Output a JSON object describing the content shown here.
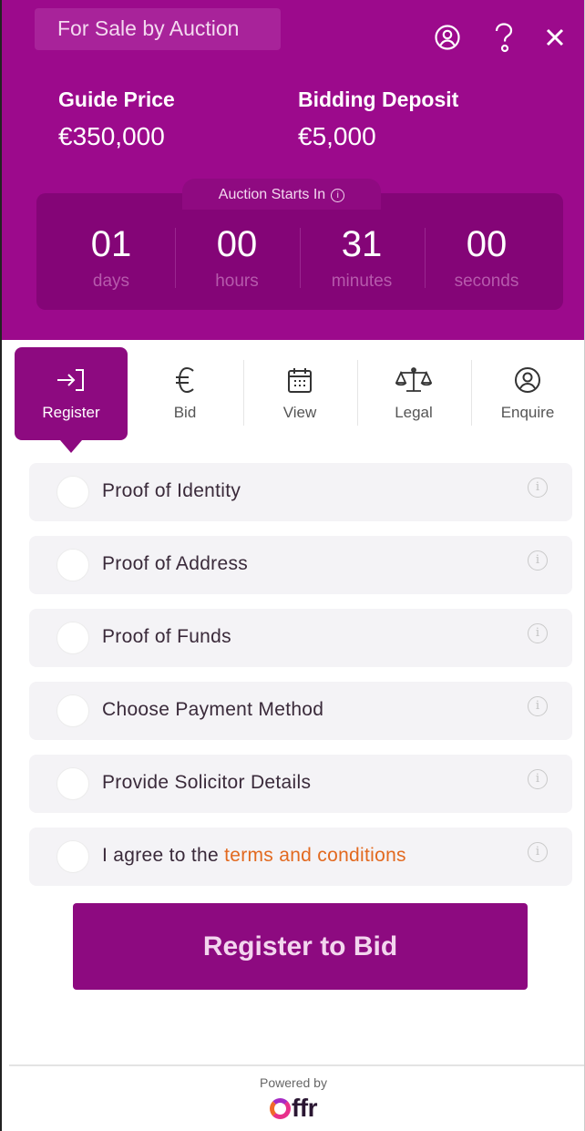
{
  "header": {
    "sale_type": "For Sale by Auction",
    "guide_price_label": "Guide Price",
    "guide_price_value": "€350,000",
    "deposit_label": "Bidding Deposit",
    "deposit_value": "€5,000",
    "icons": [
      "user-icon",
      "help-icon",
      "close-icon"
    ],
    "background": "#9c0a8c"
  },
  "countdown": {
    "caption": "Auction Starts In",
    "cells": [
      {
        "value": "01",
        "unit": "days"
      },
      {
        "value": "00",
        "unit": "hours"
      },
      {
        "value": "31",
        "unit": "minutes"
      },
      {
        "value": "00",
        "unit": "seconds"
      }
    ]
  },
  "tabs": [
    {
      "label": "Register",
      "icon": "login-arrow-icon",
      "active": true
    },
    {
      "label": "Bid",
      "icon": "euro-icon",
      "active": false
    },
    {
      "label": "View",
      "icon": "calendar-icon",
      "active": false
    },
    {
      "label": "Legal",
      "icon": "scales-icon",
      "active": false
    },
    {
      "label": "Enquire",
      "icon": "user-circle-icon",
      "active": false
    }
  ],
  "checklist": [
    {
      "label": "Proof of Identity"
    },
    {
      "label": "Proof of Address"
    },
    {
      "label": "Proof of Funds"
    },
    {
      "label": "Choose Payment Method"
    },
    {
      "label": "Provide Solicitor Details"
    },
    {
      "label_prefix": "I agree to the ",
      "link_text": "terms and conditions"
    }
  ],
  "register_button": "Register to Bid",
  "footer": {
    "powered_by": "Powered by",
    "logo_text": "Offr"
  },
  "colors": {
    "brand": "#8d0a80",
    "link": "#e2691f"
  }
}
